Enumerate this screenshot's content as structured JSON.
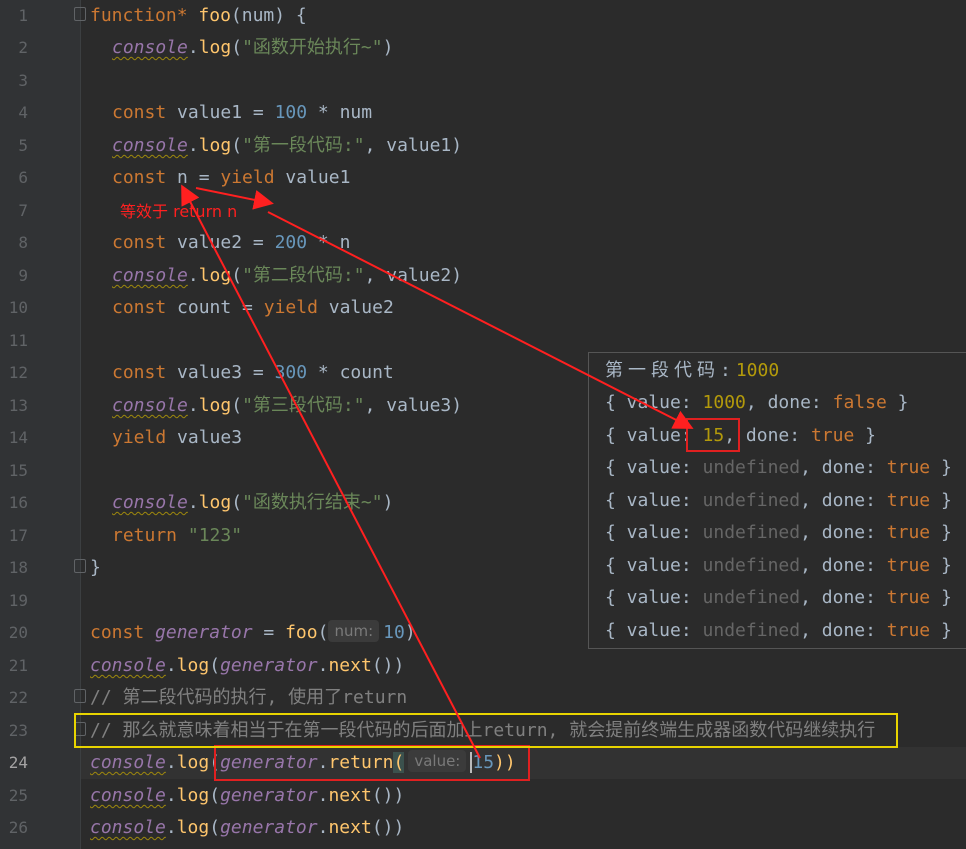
{
  "editor": {
    "line_numbers": [
      "1",
      "2",
      "3",
      "4",
      "5",
      "6",
      "7",
      "8",
      "9",
      "10",
      "11",
      "12",
      "13",
      "14",
      "15",
      "16",
      "17",
      "18",
      "19",
      "20",
      "21",
      "22",
      "23",
      "24",
      "25",
      "26"
    ],
    "current_line": "24",
    "lines": {
      "l1": [
        "function",
        "*",
        " ",
        "foo",
        "(num) {"
      ],
      "l2": [
        "console",
        ".",
        "log",
        "(",
        "\"函数开始执行~\"",
        ")"
      ],
      "l4": [
        "const",
        " value1 = ",
        "100",
        " * num"
      ],
      "l5": [
        "console",
        ".",
        "log",
        "(",
        "\"第一段代码:\"",
        ", value1)"
      ],
      "l6": [
        "const",
        " n = ",
        "yield",
        " value1"
      ],
      "l8": [
        "const",
        " value2 = ",
        "200",
        " * n"
      ],
      "l9": [
        "console",
        ".",
        "log",
        "(",
        "\"第二段代码:\"",
        ", value2)"
      ],
      "l10": [
        "const",
        " count = ",
        "yield",
        " value2"
      ],
      "l12": [
        "const",
        " value3 = ",
        "300",
        " * count"
      ],
      "l13": [
        "console",
        ".",
        "log",
        "(",
        "\"第三段代码:\"",
        ", value3)"
      ],
      "l14": [
        "yield",
        " value3"
      ],
      "l16": [
        "console",
        ".",
        "log",
        "(",
        "\"函数执行结束~\"",
        ")"
      ],
      "l17": [
        "return",
        " ",
        "\"123\""
      ],
      "l18": [
        "}"
      ],
      "l20": [
        "const",
        " ",
        "generator",
        " = ",
        "foo",
        "(",
        "num:",
        "10",
        ")"
      ],
      "l21": [
        "console",
        ".",
        "log",
        "(",
        "generator",
        ".",
        "next",
        "())"
      ],
      "l22": [
        "// 第二段代码的执行, 使用了return"
      ],
      "l23": [
        "// 那么就意味着相当于在第一段代码的后面加上return, 就会提前终端生成器函数代码继续执行"
      ],
      "l24": [
        "console",
        ".",
        "log",
        "(",
        "generator",
        ".",
        "return",
        "(",
        "value:",
        "15",
        "))"
      ],
      "l25": [
        "console",
        ".",
        "log",
        "(",
        "generator",
        ".",
        "next",
        "())"
      ],
      "l26": [
        "console",
        ".",
        "log",
        "(",
        "generator",
        ".",
        "next",
        "())"
      ]
    }
  },
  "annotation": {
    "text": "等效于 return n"
  },
  "console": {
    "line1": {
      "label": "第一段代码:",
      "value": "1000"
    },
    "line2": {
      "a": "{ value: ",
      "v": "1000",
      "b": ", done: ",
      "d": "false",
      "c": " }"
    },
    "line3": {
      "a": "{ value: ",
      "v": "15",
      "b": ", done: ",
      "d": "true",
      "c": " }"
    },
    "undef_rows": [
      {
        "a": "{ value: ",
        "v": "undefined",
        "b": ", done: ",
        "d": "true",
        "c": " }"
      },
      {
        "a": "{ value: ",
        "v": "undefined",
        "b": ", done: ",
        "d": "true",
        "c": " }"
      },
      {
        "a": "{ value: ",
        "v": "undefined",
        "b": ", done: ",
        "d": "true",
        "c": " }"
      },
      {
        "a": "{ value: ",
        "v": "undefined",
        "b": ", done: ",
        "d": "true",
        "c": " }"
      },
      {
        "a": "{ value: ",
        "v": "undefined",
        "b": ", done: ",
        "d": "true",
        "c": " }"
      },
      {
        "a": "{ value: ",
        "v": "undefined",
        "b": ", done: ",
        "d": "true",
        "c": " }"
      }
    ]
  },
  "colors": {
    "annotation_red": "#ff2020",
    "highlight_yellow": "#e8d400",
    "editor_bg": "#2b2b2b"
  }
}
